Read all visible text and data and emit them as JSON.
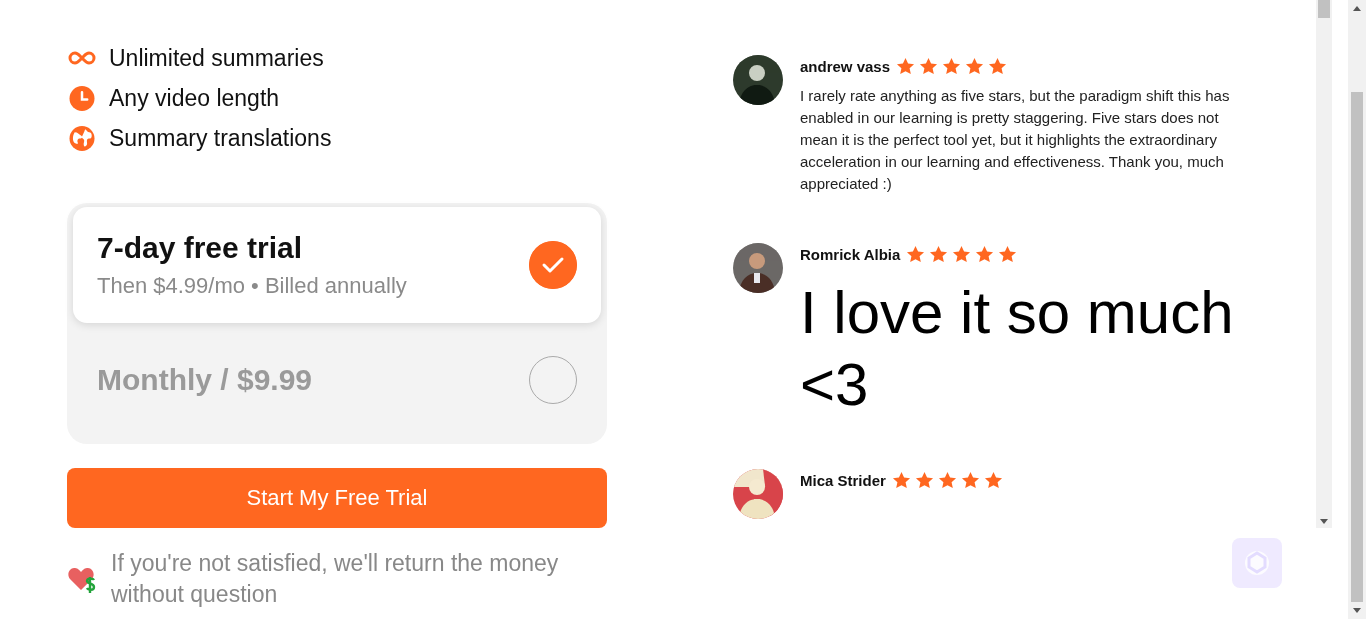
{
  "features": [
    {
      "kind": "infinity",
      "label": "Unlimited summaries"
    },
    {
      "kind": "clock",
      "label": "Any video length"
    },
    {
      "kind": "globe",
      "label": "Summary translations"
    }
  ],
  "plans": [
    {
      "title": "7-day free trial",
      "subtitle": "Then $4.99/mo • Billed annually",
      "selected": true
    },
    {
      "title": "Monthly / $9.99",
      "selected": false
    }
  ],
  "cta_button": "Start My Free Trial",
  "guarantee": "If you're not satisfied, we'll return the money without question",
  "reviews": [
    {
      "name": "andrew vass",
      "stars": 5,
      "kind": "normal",
      "text": "I rarely rate anything as five stars, but the paradigm shift this has enabled in our learning is pretty staggering. Five stars does not mean it is the perfect tool yet, but it highlights the extraordinary acceleration in our learning and effectiveness. Thank you, much appreciated :)"
    },
    {
      "name": "Romrick Albia",
      "stars": 5,
      "kind": "large",
      "text": "I love it so much <3"
    },
    {
      "name": "Mica Strider",
      "stars": 5
    }
  ]
}
